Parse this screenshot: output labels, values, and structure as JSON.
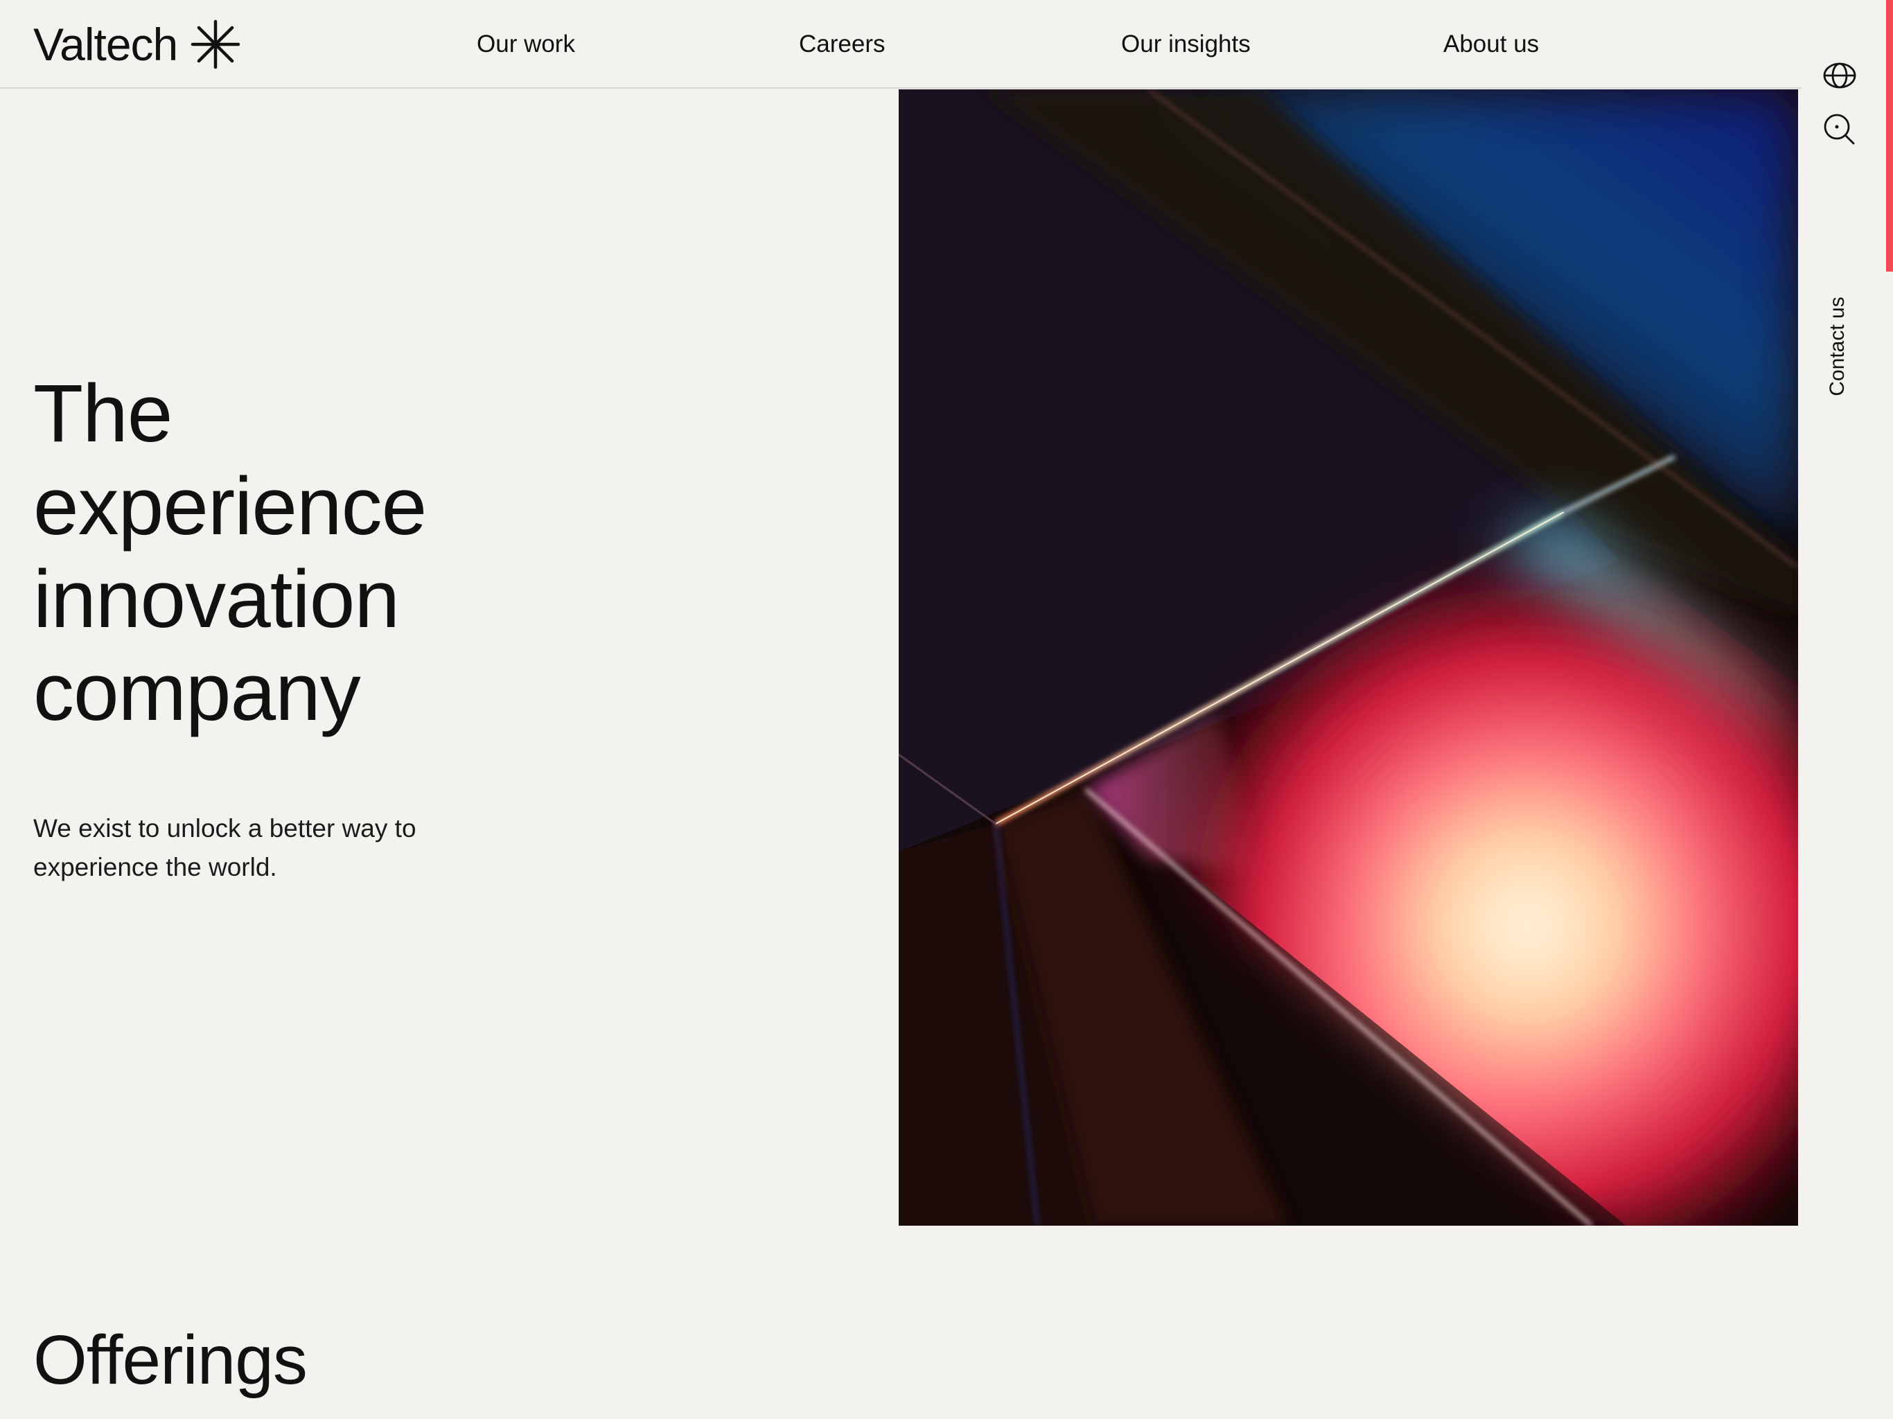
{
  "brand": {
    "name": "Valtech"
  },
  "nav": [
    {
      "label": "Our work"
    },
    {
      "label": "Careers"
    },
    {
      "label": "Our insights"
    },
    {
      "label": "About us"
    }
  ],
  "rail": {
    "contact_label": "Contact us",
    "icons": [
      "globe-icon",
      "search-icon"
    ]
  },
  "hero": {
    "title_lines": [
      "The",
      "experience",
      "innovation",
      "company"
    ],
    "subtitle": "We exist to unlock a better way to experience the world."
  },
  "sections": {
    "offerings_title": "Offerings"
  },
  "colors": {
    "background": "#f3f2ef",
    "text": "#111111",
    "accent": "#f04b55"
  }
}
